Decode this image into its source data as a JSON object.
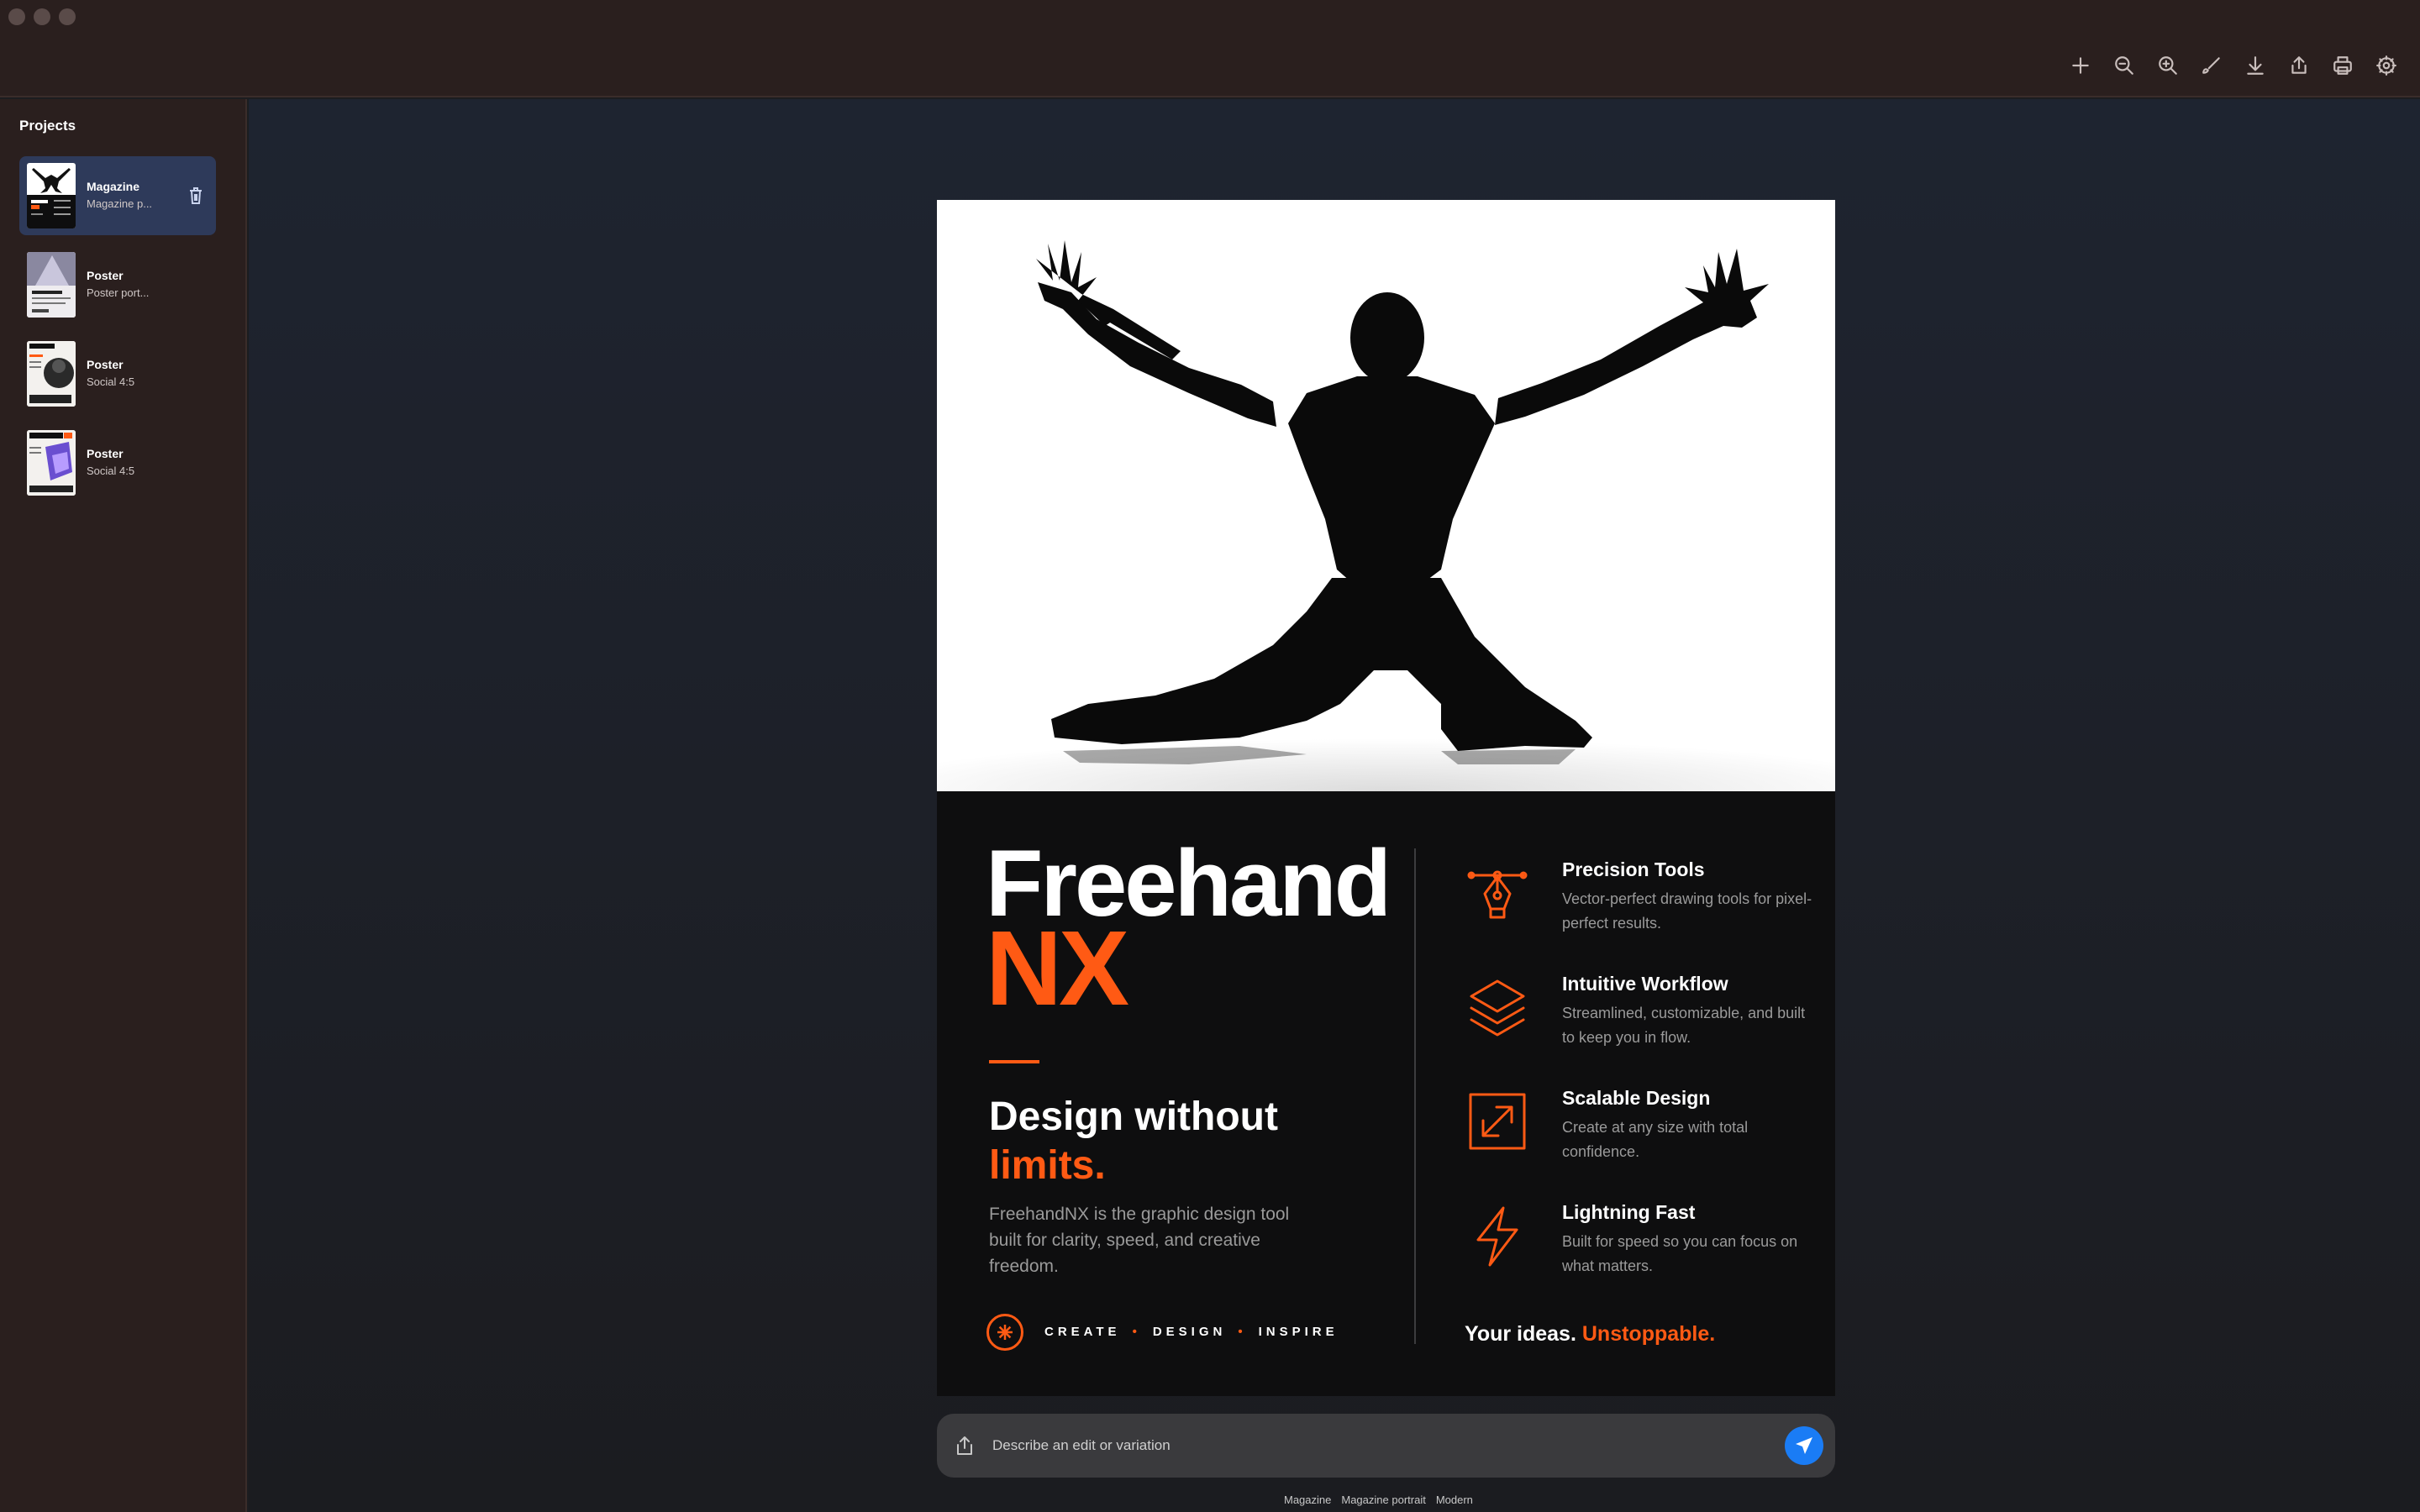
{
  "window": {
    "title": ""
  },
  "toolbar": {
    "icons": [
      "plus-icon",
      "zoom-out-icon",
      "zoom-in-icon",
      "brush-icon",
      "download-icon",
      "share-icon",
      "print-icon",
      "settings-icon"
    ]
  },
  "sidebar": {
    "title": "Projects",
    "items": [
      {
        "name": "Magazine",
        "subtitle": "Magazine p...",
        "active": true
      },
      {
        "name": "Poster",
        "subtitle": "Poster port...",
        "active": false
      },
      {
        "name": "Poster",
        "subtitle": "Social 4:5",
        "active": false
      },
      {
        "name": "Poster",
        "subtitle": "Social 4:5",
        "active": false
      }
    ]
  },
  "poster": {
    "brand_line1": "Freehand",
    "brand_line2": "NX",
    "tagline_line1": "Design without",
    "tagline_line2": "limits.",
    "description": "FreehandNX is the graphic design tool built for clarity, speed, and creative freedom.",
    "motto": [
      "CREATE",
      "DESIGN",
      "INSPIRE"
    ],
    "features": [
      {
        "icon": "pen-nib-icon",
        "title": "Precision Tools",
        "desc": "Vector-perfect drawing tools for pixel-perfect results."
      },
      {
        "icon": "layers-icon",
        "title": "Intuitive Workflow",
        "desc": "Streamlined, customizable, and built to keep you in flow."
      },
      {
        "icon": "resize-arrows-icon",
        "title": "Scalable Design",
        "desc": "Create at any size with total confidence."
      },
      {
        "icon": "lightning-icon",
        "title": "Lightning Fast",
        "desc": "Built for speed so you can focus on what matters."
      }
    ],
    "claim_plain": "Your ideas.",
    "claim_accent": "Unstoppable.",
    "accent_color": "#ff5a14"
  },
  "prompt": {
    "placeholder": "Describe an edit or variation",
    "value": ""
  },
  "chips": [
    "Magazine",
    "Magazine portrait",
    "Modern"
  ],
  "colors": {
    "send_button": "#1a7cf5",
    "active_project": "#2e3a5a"
  }
}
